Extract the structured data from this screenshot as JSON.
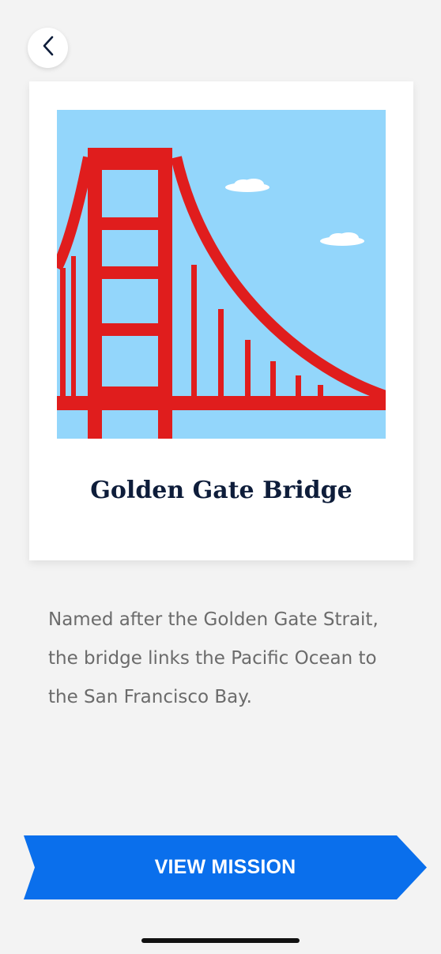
{
  "header": {
    "back_icon": "chevron-left-icon"
  },
  "card": {
    "title": "Golden Gate Bridge",
    "image_icon": "golden-gate-bridge-illustration",
    "colors": {
      "sky": "#93d6fb",
      "bridge": "#e01d1d",
      "cloud": "#ffffff"
    }
  },
  "description": "Named after the Golden Gate Strait, the bridge links the Pacific Ocean to the San Francisco Bay.",
  "cta": {
    "label": "VIEW MISSION",
    "color": "#0a6fec"
  },
  "colors": {
    "background": "#f3f3f3",
    "title_text": "#0e1d3a",
    "body_text": "#6b6b6b"
  }
}
